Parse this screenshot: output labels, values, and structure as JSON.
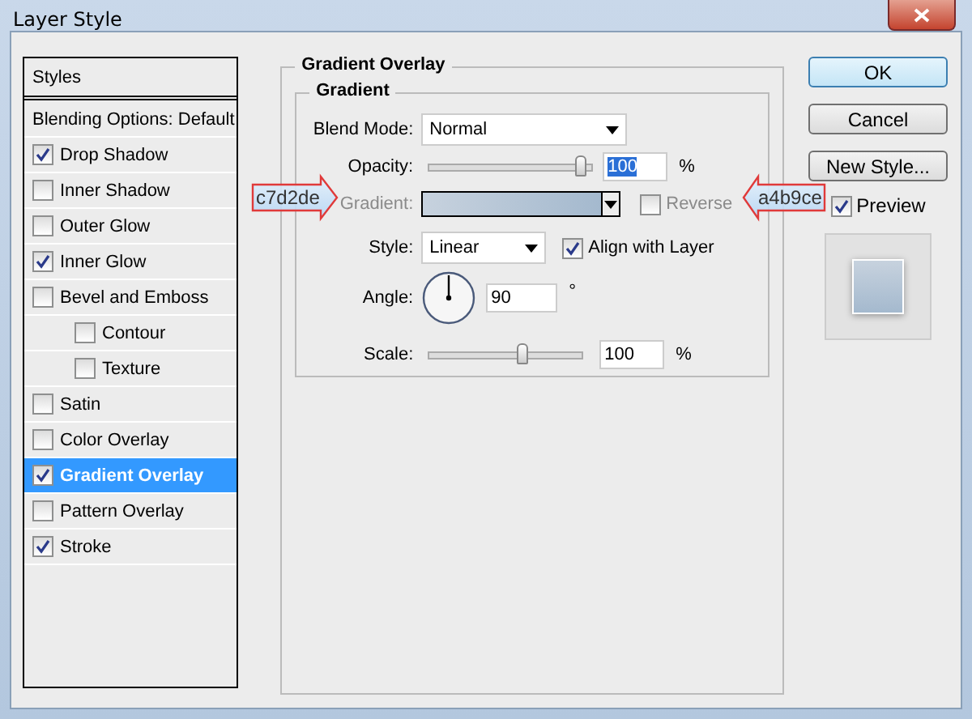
{
  "window": {
    "title": "Layer Style"
  },
  "styles_list": {
    "header": "Styles",
    "items": [
      {
        "label": "Blending Options: Default",
        "kind": "plain",
        "selected": false
      },
      {
        "label": "Drop Shadow",
        "kind": "check",
        "checked": true,
        "selected": false
      },
      {
        "label": "Inner Shadow",
        "kind": "check",
        "checked": false,
        "selected": false
      },
      {
        "label": "Outer Glow",
        "kind": "check",
        "checked": false,
        "selected": false
      },
      {
        "label": "Inner Glow",
        "kind": "check",
        "checked": true,
        "selected": false
      },
      {
        "label": "Bevel and Emboss",
        "kind": "check",
        "checked": false,
        "selected": false,
        "children": [
          {
            "label": "Contour",
            "kind": "check",
            "checked": false,
            "selected": false
          },
          {
            "label": "Texture",
            "kind": "check",
            "checked": false,
            "selected": false
          }
        ]
      },
      {
        "label": "Satin",
        "kind": "check",
        "checked": false,
        "selected": false
      },
      {
        "label": "Color Overlay",
        "kind": "check",
        "checked": false,
        "selected": false
      },
      {
        "label": "Gradient Overlay",
        "kind": "check",
        "checked": true,
        "selected": true
      },
      {
        "label": "Pattern Overlay",
        "kind": "check",
        "checked": false,
        "selected": false
      },
      {
        "label": "Stroke",
        "kind": "check",
        "checked": true,
        "selected": false
      }
    ]
  },
  "gradient_overlay": {
    "title": "Gradient Overlay",
    "group": {
      "title": "Gradient",
      "blend_mode": {
        "label": "Blend Mode:",
        "value": "Normal"
      },
      "opacity": {
        "label": "Opacity:",
        "level": 0.97,
        "value": "100",
        "unit": "%"
      },
      "gradient": {
        "label": "Gradient:",
        "reverse": {
          "label": "Reverse",
          "checked": false
        }
      },
      "style": {
        "label": "Style:",
        "value": "Linear",
        "align": {
          "label": "Align with Layer",
          "checked": true
        }
      },
      "angle": {
        "label": "Angle:",
        "value": "90",
        "unit": "°"
      },
      "scale": {
        "label": "Scale:",
        "level": 0.62,
        "value": "100",
        "unit": "%"
      }
    }
  },
  "buttons": [
    {
      "label": "OK",
      "default": true
    },
    {
      "label": "Cancel",
      "default": false
    },
    {
      "label": "New Style...",
      "default": false
    }
  ],
  "preview": {
    "label": "Preview",
    "checked": true
  },
  "annotations": [
    {
      "text": "c7d2de",
      "color": "#c7d2de",
      "kind": "pointing-right"
    },
    {
      "text": "a4b9ce",
      "color": "#a4b9ce",
      "kind": "pointing-left"
    }
  ]
}
